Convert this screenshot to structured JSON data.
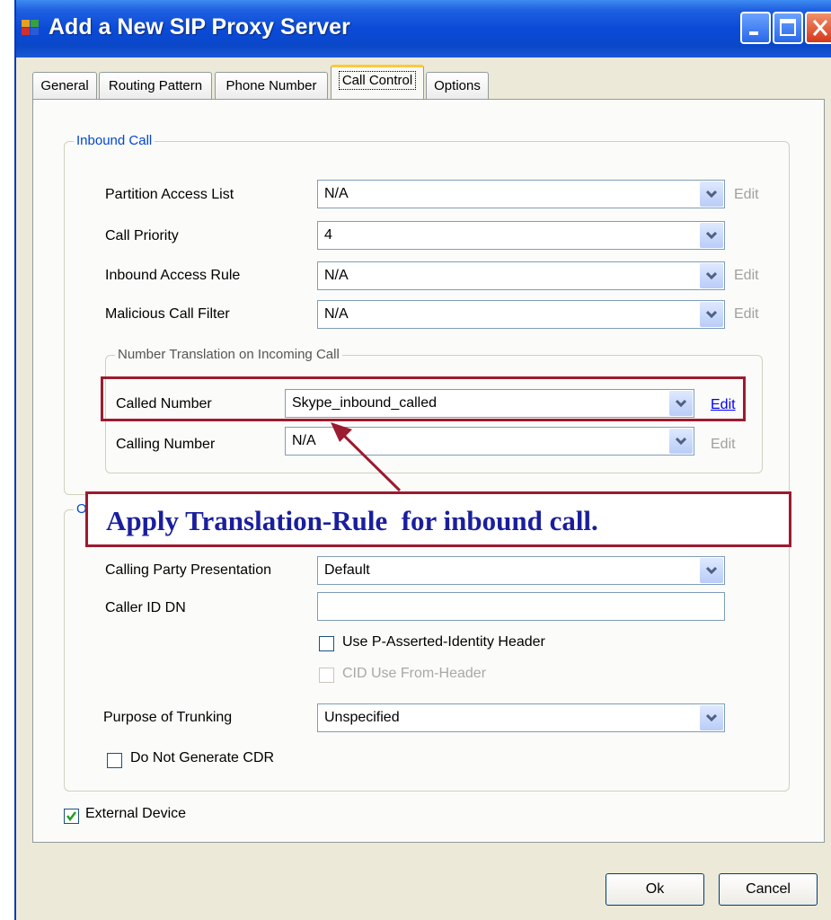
{
  "window": {
    "title": "Add a New SIP Proxy Server"
  },
  "tabs": [
    {
      "label": "General"
    },
    {
      "label": "Routing Pattern"
    },
    {
      "label": "Phone Number"
    },
    {
      "label": "Call Control"
    },
    {
      "label": "Options"
    }
  ],
  "active_tab": "Call Control",
  "inbound": {
    "group_title": "Inbound Call",
    "partition_access_list": {
      "label": "Partition Access List",
      "value": "N/A",
      "edit": "Edit"
    },
    "call_priority": {
      "label": "Call Priority",
      "value": "4"
    },
    "inbound_access_rule": {
      "label": "Inbound Access Rule",
      "value": "N/A",
      "edit": "Edit"
    },
    "malicious_call_filter": {
      "label": "Malicious Call Filter",
      "value": "N/A",
      "edit": "Edit"
    },
    "translation": {
      "group_title": "Number Translation on Incoming Call",
      "called_number": {
        "label": "Called Number",
        "value": "Skype_inbound_called",
        "edit": "Edit"
      },
      "calling_number": {
        "label": "Calling Number",
        "value": "N/A",
        "edit": "Edit"
      }
    }
  },
  "outbound": {
    "group_title_partial": "O",
    "calling_party_presentation": {
      "label": "Calling Party Presentation",
      "value": "Default"
    },
    "caller_id_dn": {
      "label": "Caller ID DN",
      "value": ""
    },
    "use_pai_header": {
      "label": "Use P-Asserted-Identity Header",
      "checked": false
    },
    "cid_use_from_header": {
      "label": "CID Use From-Header",
      "checked": false,
      "disabled": true
    },
    "purpose_of_trunking": {
      "label": "Purpose of Trunking",
      "value": "Unspecified"
    },
    "do_not_generate_cdr": {
      "label": "Do Not Generate CDR",
      "checked": false
    }
  },
  "external_device": {
    "label": "External Device",
    "checked": true
  },
  "callout": {
    "text": "Apply Translation-Rule  for inbound call."
  },
  "buttons": {
    "ok": "Ok",
    "cancel": "Cancel"
  },
  "colors": {
    "title_bar": "#0a4ad8",
    "annotation_border": "#9b1b30",
    "annotation_text": "#1a1e9e",
    "group_title": "#0046d5",
    "link": "#0000ff"
  }
}
